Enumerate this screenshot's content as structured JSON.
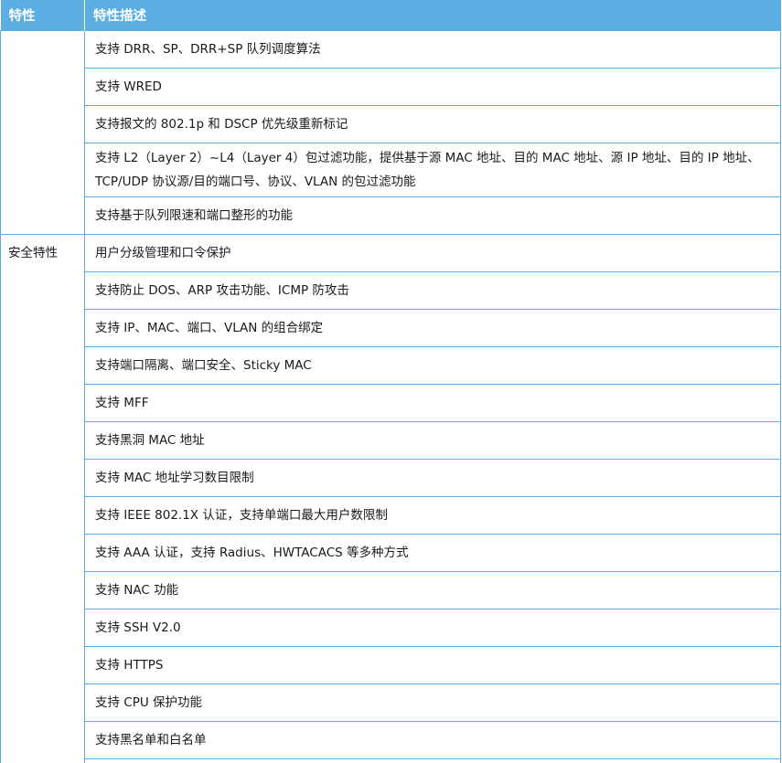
{
  "table": {
    "headers": [
      "特性",
      "特性描述"
    ],
    "groups": [
      {
        "feature": "",
        "descriptions": [
          "支持 DRR、SP、DRR+SP 队列调度算法",
          "支持 WRED",
          "支持报文的 802.1p 和 DSCP 优先级重新标记",
          "支持 L2（Layer 2）~L4（Layer 4）包过滤功能，提供基于源 MAC 地址、目的 MAC 地址、源 IP 地址、目的 IP 地址、TCP/UDP 协议源/目的端口号、协议、VLAN 的包过滤功能",
          "支持基于队列限速和端口整形的功能"
        ]
      },
      {
        "feature": "安全特性",
        "descriptions": [
          "用户分级管理和口令保护",
          "支持防止 DOS、ARP 攻击功能、ICMP 防攻击",
          "支持 IP、MAC、端口、VLAN 的组合绑定",
          "支持端口隔离、端口安全、Sticky MAC",
          "支持 MFF",
          "支持黑洞 MAC 地址",
          "支持 MAC 地址学习数目限制",
          "支持 IEEE 802.1X 认证，支持单端口最大用户数限制",
          "支持 AAA 认证，支持 Radius、HWTACACS 等多种方式",
          "支持 NAC 功能",
          "支持 SSH V2.0",
          "支持 HTTPS",
          "支持 CPU 保护功能",
          "支持黑名单和白名单"
        ]
      }
    ]
  },
  "colors": {
    "header_bg": "#5aaee4",
    "header_text": "#ffffff",
    "border": "#5aaee4",
    "body_text": "#1a1a1a"
  }
}
